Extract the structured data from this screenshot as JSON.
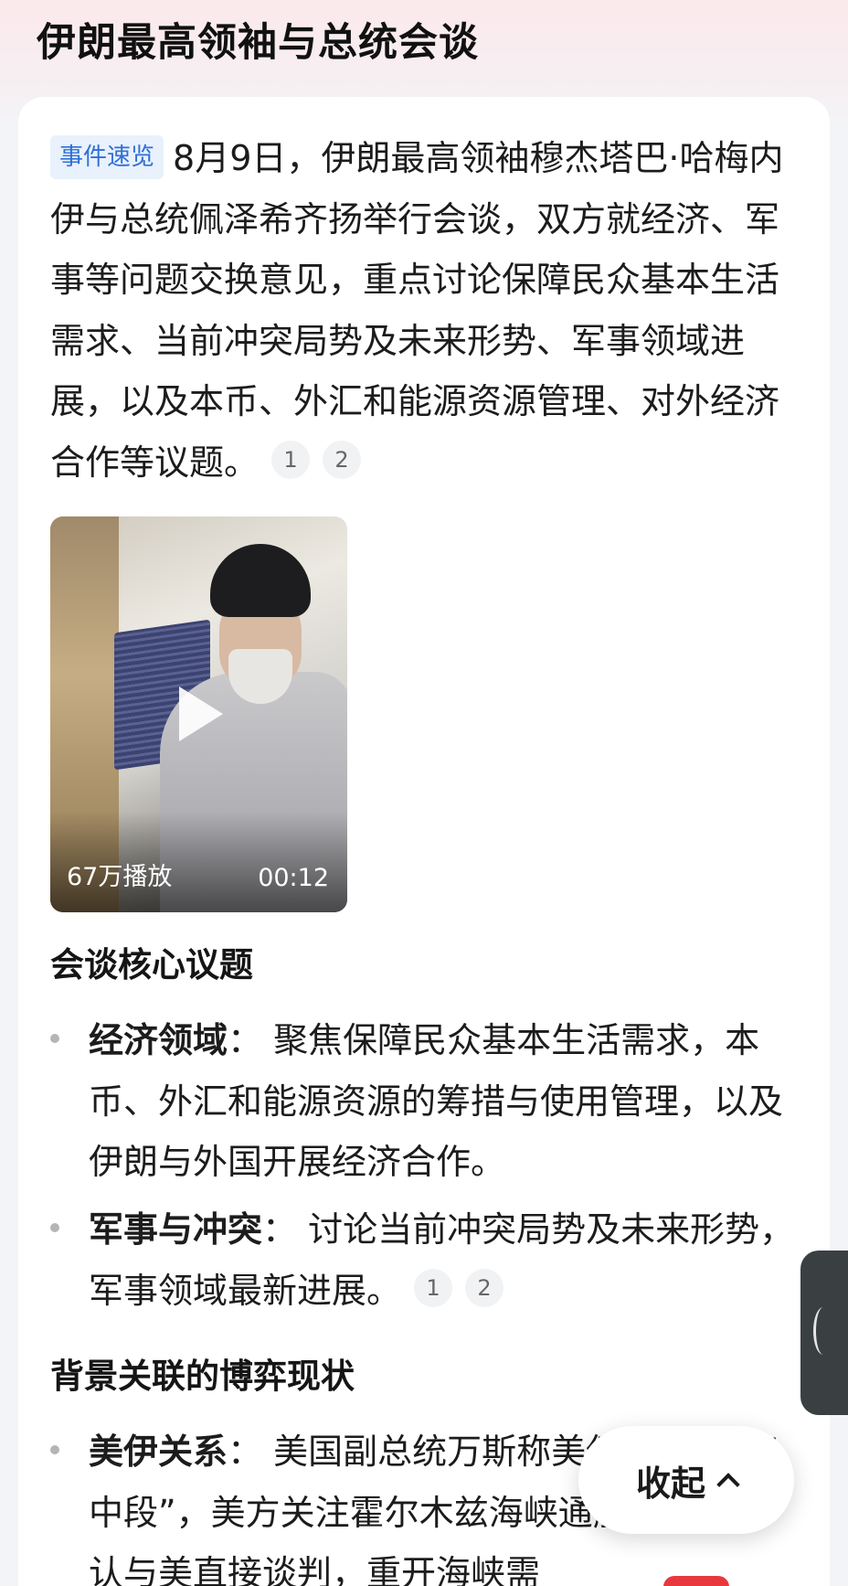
{
  "page_title": "伊朗最高领袖与总统会谈",
  "summary": {
    "tag": "事件速览",
    "text": "8月9日，伊朗最高领袖穆杰塔巴·哈梅内伊与总统佩泽希齐扬举行会谈，双方就经济、军事等问题交换意见，重点讨论保障民众基本生活需求、当前冲突局势及未来形势、军事领域进展，以及本币、外汇和能源资源管理、对外经济合作等议题。",
    "citations": [
      "1",
      "2"
    ]
  },
  "video": {
    "views": "67万播放",
    "duration": "00:12",
    "play_icon": "play-icon"
  },
  "section1": {
    "heading": "会谈核心议题",
    "bullets": [
      {
        "term": "经济领域",
        "sep": "：",
        "text": "聚焦保障民众基本生活需求，本币、外汇和能源资源的筹措与使用管理，以及伊朗与外国开展经济合作。"
      },
      {
        "term": "军事与冲突",
        "sep": "：",
        "text": "讨论当前冲突局势及未来形势，军事领域最新进展。",
        "citations": [
          "1",
          "2"
        ]
      }
    ]
  },
  "section2": {
    "heading": "背景关联的博弈现状",
    "bullets": [
      {
        "term": "美伊关系",
        "sep": "：",
        "text": "美国副总统万斯称美伊处于“博弈中段”，美方关注霍尔木兹海峡通航；伊朗否认与美直接谈判，重开海峡需"
      }
    ]
  },
  "collapse_button": {
    "label": "收起",
    "icon": "chevron-up-icon"
  },
  "side_tab_icon": "chevron-left-icon",
  "colors": {
    "tag_bg": "#e8f1fc",
    "tag_text": "#2f6fd6",
    "side_tab": "#3a3f42",
    "accent_red": "#e8383d"
  }
}
